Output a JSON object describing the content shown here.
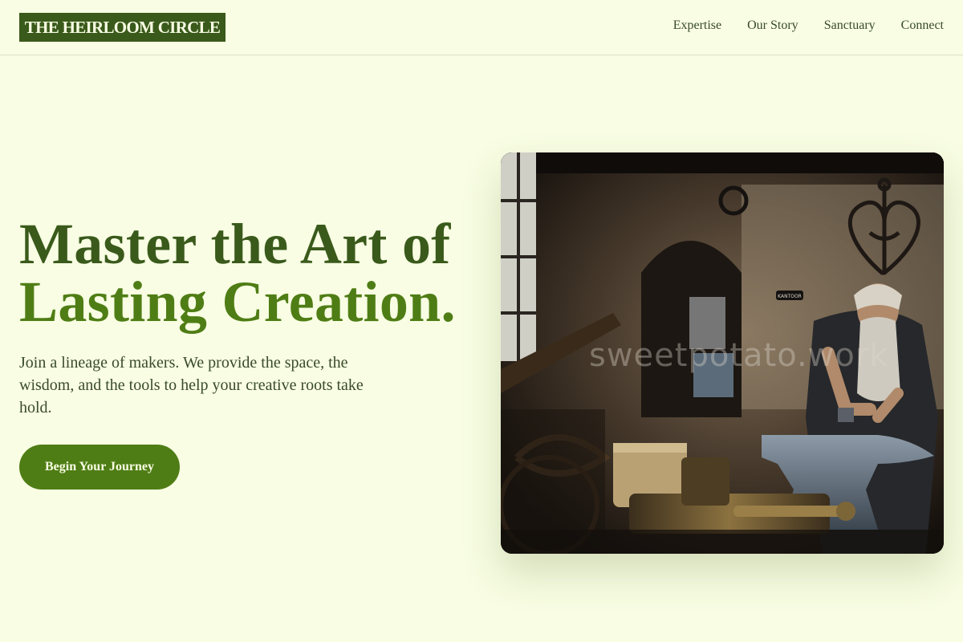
{
  "header": {
    "logo": "THE HEIRLOOM CIRCLE",
    "nav": [
      "Expertise",
      "Our Story",
      "Sanctuary",
      "Connect"
    ]
  },
  "hero": {
    "title_line1": "Master the Art of",
    "title_line2": "Lasting Creation.",
    "subtitle": "Join a lineage of makers. We provide the space, the wisdom, and the tools to help your creative roots take hold.",
    "cta": "Begin Your Journey"
  },
  "photo": {
    "watermark": "sweetpotato.work",
    "sign_text": "KANTOOR"
  },
  "colors": {
    "background": "#f8fde3",
    "primary_dark": "#3a5a1b",
    "primary": "#4f7d15"
  }
}
